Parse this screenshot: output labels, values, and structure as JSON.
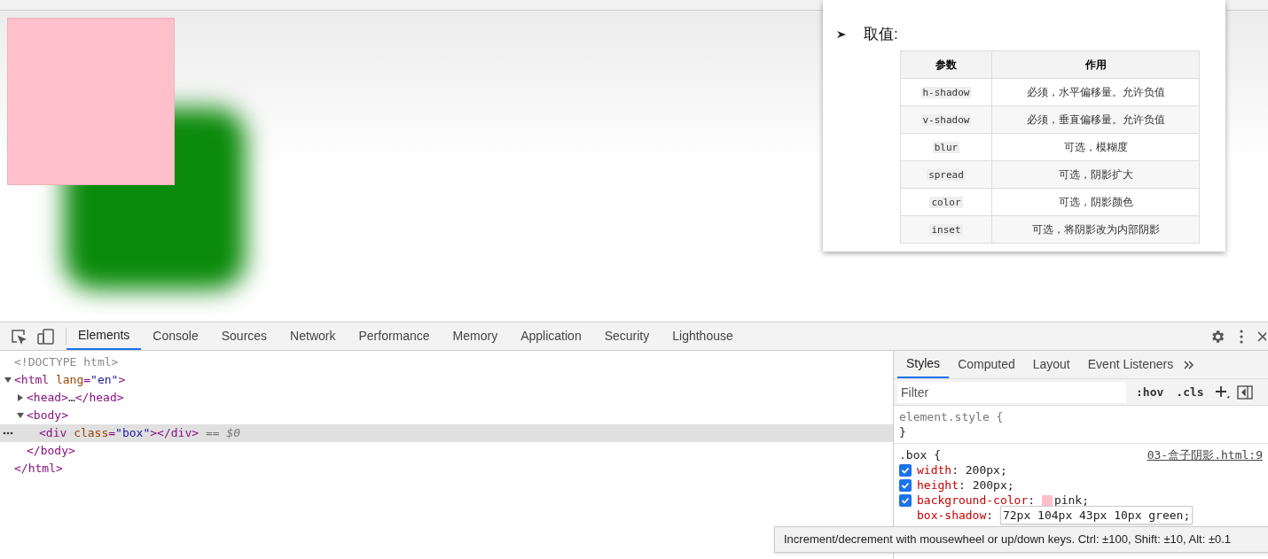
{
  "page": {
    "popup": {
      "heading": "取值:",
      "table": {
        "columns": [
          "参数",
          "作用"
        ],
        "rows": [
          {
            "param": "h-shadow",
            "desc": "必须，水平偏移量。允许负值"
          },
          {
            "param": "v-shadow",
            "desc": "必须，垂直偏移量。允许负值"
          },
          {
            "param": "blur",
            "desc": "可选，模糊度"
          },
          {
            "param": "spread",
            "desc": "可选，阴影扩大"
          },
          {
            "param": "color",
            "desc": "可选，阴影颜色"
          },
          {
            "param": "inset",
            "desc": "可选，将阴影改为内部阴影"
          }
        ]
      }
    }
  },
  "devtools": {
    "tabs": [
      {
        "label": "Elements",
        "selected": true
      },
      {
        "label": "Console",
        "selected": false
      },
      {
        "label": "Sources",
        "selected": false
      },
      {
        "label": "Network",
        "selected": false
      },
      {
        "label": "Performance",
        "selected": false
      },
      {
        "label": "Memory",
        "selected": false
      },
      {
        "label": "Application",
        "selected": false
      },
      {
        "label": "Security",
        "selected": false
      },
      {
        "label": "Lighthouse",
        "selected": false
      }
    ],
    "dom": [
      {
        "open": [
          {
            "kind": "comment",
            "s": "<!DOCTYPE html>"
          }
        ],
        "selected": false
      },
      {
        "open": [
          {
            "kind": "tag",
            "s": "<html"
          },
          {
            "kind": "attr",
            "s": " lang"
          },
          {
            "kind": "tag",
            "s": "="
          },
          {
            "kind": "val",
            "s": "\"en\""
          },
          {
            "kind": "tag",
            "s": ">"
          }
        ],
        "close": [
          {
            "kind": "tag",
            "s": "</html>"
          }
        ],
        "expanded": true,
        "selected": false,
        "children": [
          {
            "open": [
              {
                "kind": "tag",
                "s": "<head>"
              }
            ],
            "inner": "…",
            "close": [
              {
                "kind": "tag",
                "s": "</head>"
              }
            ],
            "expanded": false,
            "selected": false
          },
          {
            "open": [
              {
                "kind": "tag",
                "s": "<body>"
              }
            ],
            "close": [
              {
                "kind": "tag",
                "s": "</body>"
              }
            ],
            "expanded": true,
            "selected": false,
            "children": [
              {
                "open": [
                  {
                    "kind": "tag",
                    "s": "<div"
                  },
                  {
                    "kind": "attr",
                    "s": " class"
                  },
                  {
                    "kind": "tag",
                    "s": "="
                  },
                  {
                    "kind": "val",
                    "s": "\"box\""
                  },
                  {
                    "kind": "tag",
                    "s": "></div>"
                  }
                ],
                "suffix": "== $0",
                "selected": true
              }
            ]
          }
        ]
      }
    ],
    "styles": {
      "tabs": [
        {
          "label": "Styles",
          "selected": true
        },
        {
          "label": "Computed",
          "selected": false
        },
        {
          "label": "Layout",
          "selected": false
        },
        {
          "label": "Event Listeners",
          "selected": false
        }
      ],
      "filter": {
        "placeholder": "Filter"
      },
      "buttons": [
        ":hov",
        ".cls"
      ],
      "rules": [
        {
          "selector": "element.style {",
          "close": "}"
        },
        {
          "selector": ".box {",
          "source": "03-盒子阴影.html:9",
          "props": [
            {
              "kind": "property",
              "name": "width",
              "sep": ": ",
              "value": "200px;",
              "checked": true
            },
            {
              "kind": "property",
              "name": "height",
              "sep": ": ",
              "value": "200px;",
              "checked": true
            },
            {
              "kind": "property",
              "name": "background-color",
              "sep": ": ",
              "color": "#ffc0cb",
              "value": "pink;",
              "checked": true
            },
            {
              "kind": "editing",
              "name": "box-shadow",
              "sep": ": ",
              "value": "72px 104px 43px 10px green;"
            }
          ]
        }
      ]
    },
    "tooltip": "Increment/decrement with mousewheel or up/down keys. Ctrl: ±100, Shift: ±10, Alt: ±0.1"
  }
}
